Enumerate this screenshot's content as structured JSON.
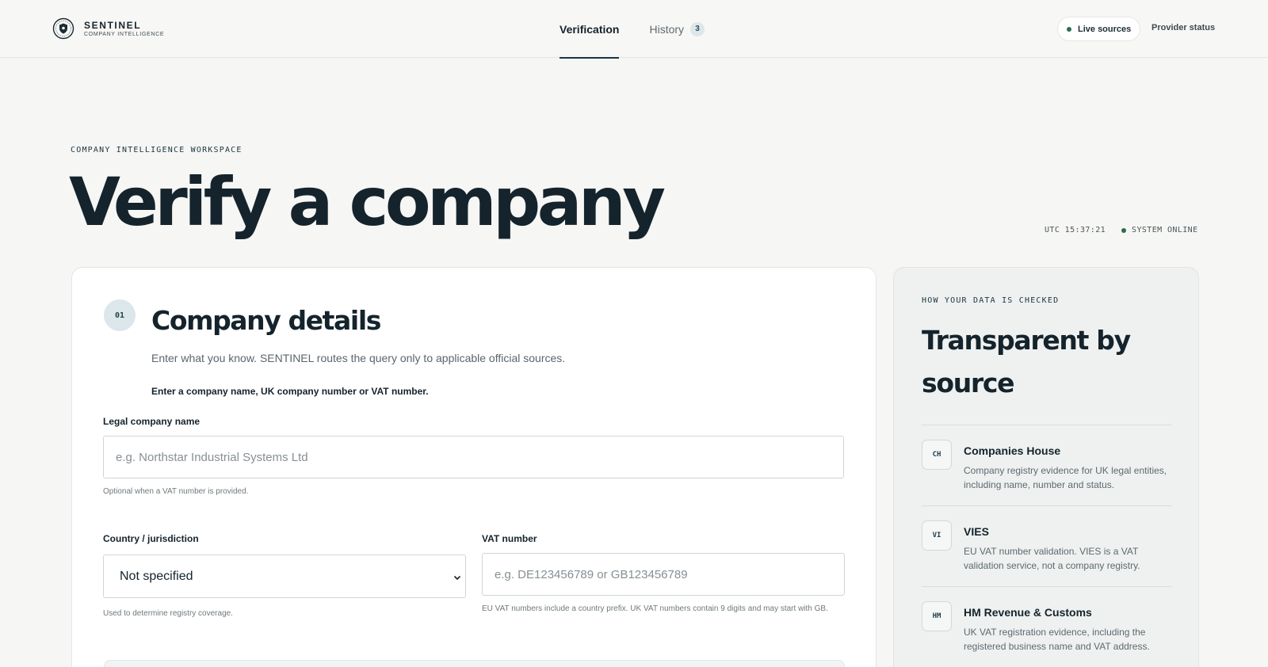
{
  "brand": {
    "name": "SENTINEL",
    "subtitle": "COMPANY INTELLIGENCE"
  },
  "nav": {
    "tabs": [
      {
        "label": "Verification",
        "active": true
      },
      {
        "label": "History",
        "badge": "3",
        "active": false
      }
    ],
    "live_sources_label": "Live sources",
    "provider_status_label": "Provider status"
  },
  "hero": {
    "eyebrow": "COMPANY INTELLIGENCE WORKSPACE",
    "title": "Verify a company",
    "utc_time": "UTC 15:37:21",
    "system_status": "SYSTEM ONLINE"
  },
  "form": {
    "step": "01",
    "title": "Company details",
    "description": "Enter what you know. SENTINEL routes the query only to applicable official sources.",
    "hint": "Enter a company name, UK company number or VAT number.",
    "legal_name": {
      "label": "Legal company name",
      "value": "",
      "placeholder": "e.g. Northstar Industrial Systems Ltd",
      "help": "Optional when a VAT number is provided."
    },
    "country": {
      "label": "Country / jurisdiction",
      "selected": "Not specified",
      "help": "Used to determine registry coverage."
    },
    "vat": {
      "label": "VAT number",
      "value": "",
      "placeholder": "e.g. DE123456789 or GB123456789",
      "help": "EU VAT numbers include a country prefix. UK VAT numbers contain 9 digits and may start with GB."
    }
  },
  "sidebar": {
    "eyebrow": "HOW YOUR DATA IS CHECKED",
    "title": "Transparent by source",
    "sources": [
      {
        "code": "CH",
        "name": "Companies House",
        "description": "Company registry evidence for UK legal entities, including name, number and status."
      },
      {
        "code": "VI",
        "name": "VIES",
        "description": "EU VAT number validation. VIES is a VAT validation service, not a company registry."
      },
      {
        "code": "HM",
        "name": "HM Revenue & Customs",
        "description": "UK VAT registration evidence, including the registered business name and VAT address."
      }
    ]
  },
  "colors": {
    "accent": "#1b3441",
    "status_green": "#2f6b4d",
    "background": "#f6f6f4"
  },
  "icons": {
    "brand": "shield-logo-icon",
    "select": "chevron-down-icon"
  }
}
